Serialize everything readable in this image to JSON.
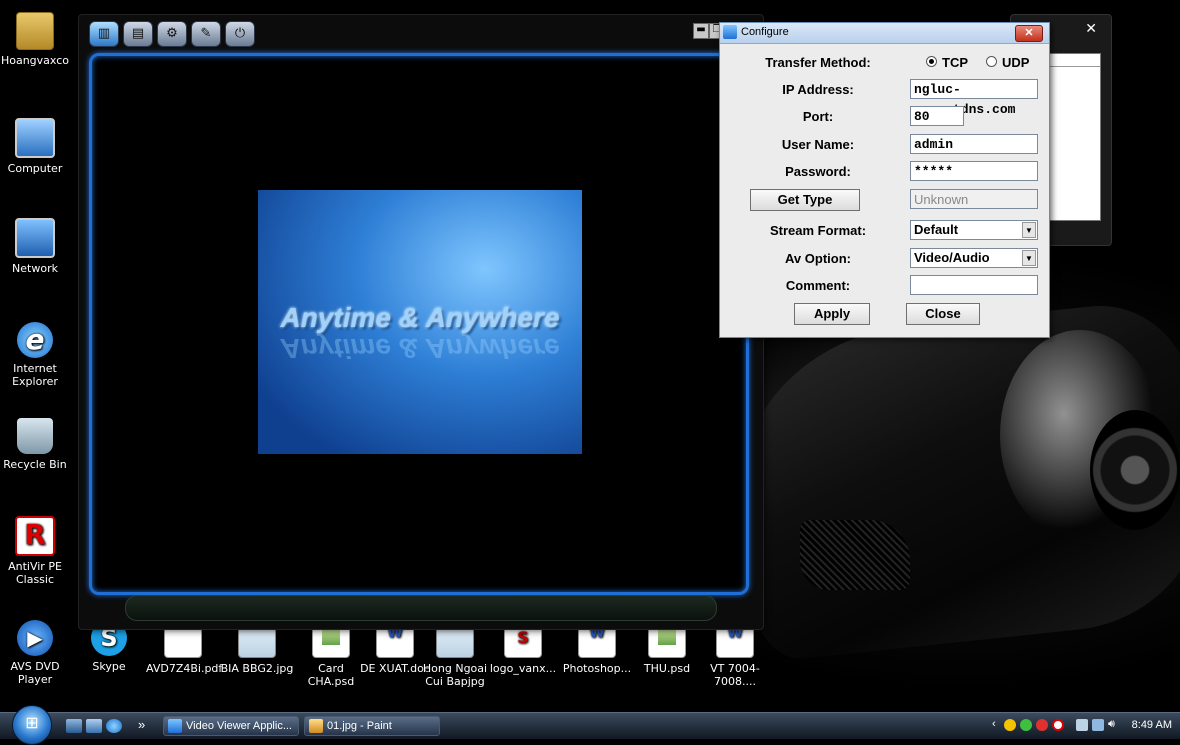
{
  "desktop": {
    "icons": [
      {
        "label": "Hoangvaxco"
      },
      {
        "label": "Computer"
      },
      {
        "label": "Network"
      },
      {
        "label": "Internet Explorer"
      },
      {
        "label": "Recycle Bin"
      },
      {
        "label": "AntiVir PE Classic"
      },
      {
        "label": "AVS DVD Player"
      },
      {
        "label": "Skype"
      },
      {
        "label": "AVD7Z4Bi.pdf"
      },
      {
        "label": "BIA BBG2.jpg"
      },
      {
        "label": "Card CHA.psd"
      },
      {
        "label": "DE XUAT.doc"
      },
      {
        "label": "Hong Ngoai Cui Bapjpg"
      },
      {
        "label": "logo_vanx..."
      },
      {
        "label": "Photoshop..."
      },
      {
        "label": "THU.psd"
      },
      {
        "label": "VT 7004-7008...."
      }
    ]
  },
  "viewer": {
    "splash_text": "Anytime & Anywhere"
  },
  "configure": {
    "title": "Configure",
    "close_glyph": "✕",
    "transfer_method_label": "Transfer Method:",
    "tcp_label": "TCP",
    "udp_label": "UDP",
    "transfer_method_selected": "TCP",
    "ip_label": "IP Address:",
    "ip_value": "ngluc-co.gotdns.com",
    "port_label": "Port:",
    "port_value": "80",
    "username_label": "User Name:",
    "username_value": "admin",
    "password_label": "Password:",
    "password_value": "*****",
    "get_type_label": "Get Type",
    "type_value": "Unknown",
    "stream_format_label": "Stream Format:",
    "stream_format_value": "Default",
    "av_option_label": "Av Option:",
    "av_option_value": "Video/Audio",
    "comment_label": "Comment:",
    "comment_value": "",
    "apply_label": "Apply",
    "close_label": "Close"
  },
  "taskbar": {
    "tasks": [
      {
        "label": "Video Viewer Applic..."
      },
      {
        "label": "01.jpg - Paint"
      }
    ],
    "clock": "8:49 AM",
    "overflow": "»"
  }
}
